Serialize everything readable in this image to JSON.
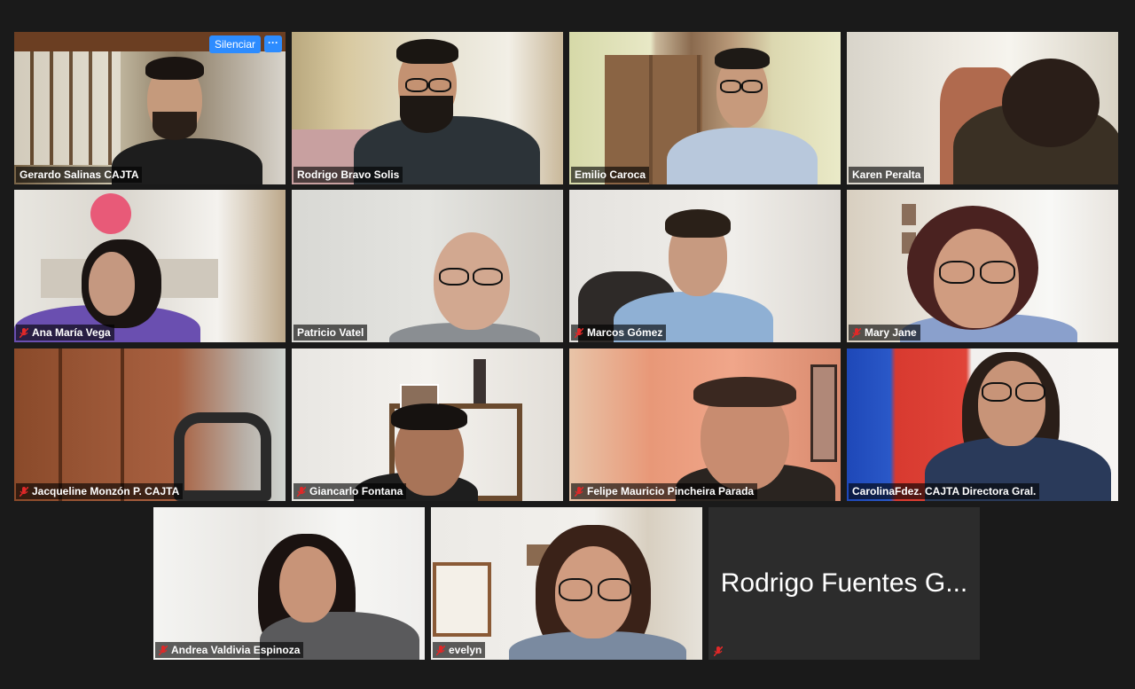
{
  "controls": {
    "mute_label": "Silenciar",
    "more_label": "···"
  },
  "participants": [
    {
      "name": "Gerardo Salinas CAJTA",
      "muted": false
    },
    {
      "name": "Rodrigo Bravo Solis",
      "muted": false
    },
    {
      "name": "Emilio Caroca",
      "muted": false,
      "active_speaker": true
    },
    {
      "name": "Karen Peralta",
      "muted": false
    },
    {
      "name": "Ana María Vega",
      "muted": true
    },
    {
      "name": "Patricio Vatel",
      "muted": false
    },
    {
      "name": "Marcos Gómez",
      "muted": true
    },
    {
      "name": "Mary Jane",
      "muted": true
    },
    {
      "name": "Jacqueline Monzón P. CAJTA",
      "muted": true
    },
    {
      "name": "Giancarlo Fontana",
      "muted": true
    },
    {
      "name": "Felipe Mauricio Pincheira Parada",
      "muted": true
    },
    {
      "name": "CarolinaFdez. CAJTA Directora Gral.",
      "muted": false
    },
    {
      "name": "Andrea Valdivia Espinoza",
      "muted": true
    },
    {
      "name": "evelyn",
      "muted": true
    },
    {
      "name": "Rodrigo Fuentes G...",
      "muted": true,
      "video_off": true
    }
  ],
  "colors": {
    "accent": "#2d8cff",
    "active_border": "#c9d86a",
    "mute_icon": "#e02828"
  }
}
